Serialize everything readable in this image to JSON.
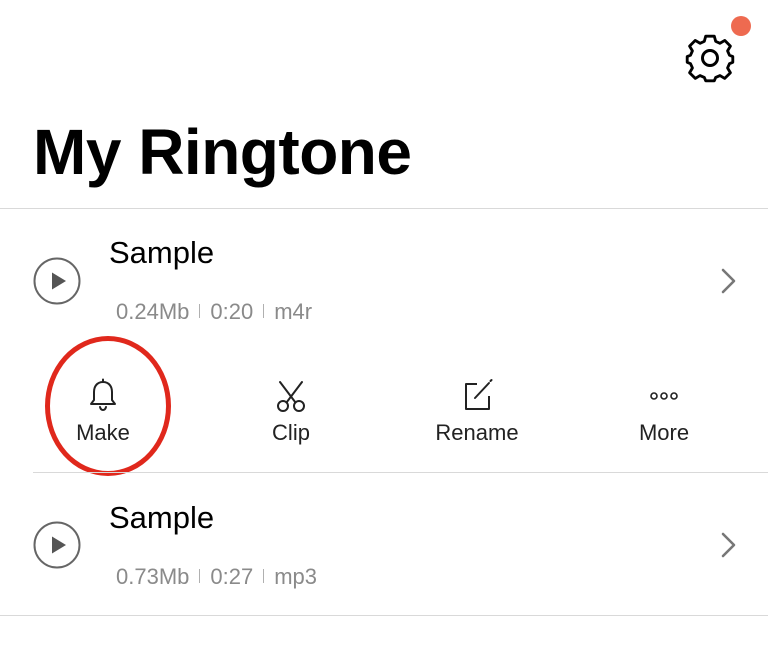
{
  "header": {
    "title": "My Ringtone",
    "settings_icon": "gear-icon",
    "notification_dot_color": "#ee6a50"
  },
  "ringtones": [
    {
      "name": "Sample",
      "size": "0.24Mb",
      "duration": "0:20",
      "format": "m4r"
    },
    {
      "name": "Sample",
      "size": "0.73Mb",
      "duration": "0:27",
      "format": "mp3"
    }
  ],
  "actions": {
    "make": {
      "label": "Make",
      "icon": "bell-icon"
    },
    "clip": {
      "label": "Clip",
      "icon": "scissors-icon"
    },
    "rename": {
      "label": "Rename",
      "icon": "edit-icon"
    },
    "more": {
      "label": "More",
      "icon": "more-icon"
    }
  },
  "highlight": {
    "target": "make-action",
    "color": "#e0281c"
  }
}
